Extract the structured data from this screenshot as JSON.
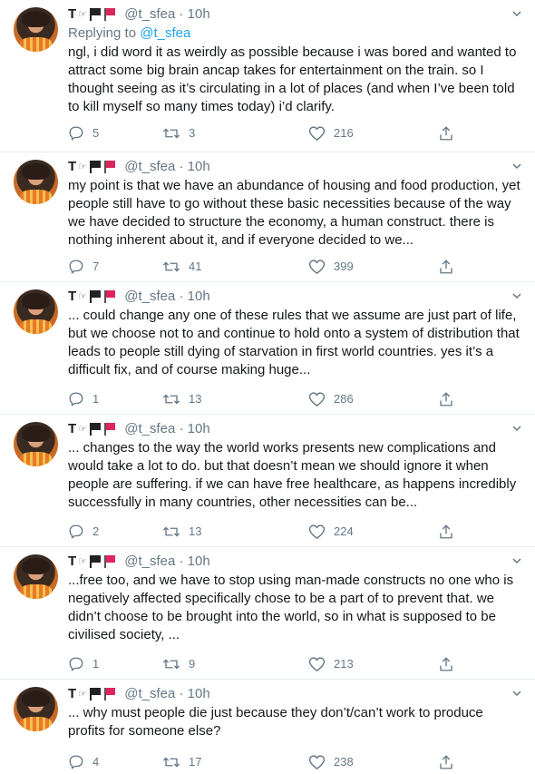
{
  "tweets": [
    {
      "name": "T",
      "handle": "@t_sfea",
      "dot": "·",
      "time": "10h",
      "replying_prefix": "Replying to",
      "replying_to": "@t_sfea",
      "text": "ngl, i did word it as weirdly as possible because i was bored and wanted to attract some big brain ancap takes for entertainment on the train. so I thought seeing as it’s circulating in a lot of places (and when I’ve been told to kill myself so many times today) i’d clarify.",
      "replies": "5",
      "retweets": "3",
      "likes": "216"
    },
    {
      "name": "T",
      "handle": "@t_sfea",
      "dot": "·",
      "time": "10h",
      "text": "my point is that we have an abundance of housing and food production, yet people still have to go without these basic necessities because of the way we have decided to structure the economy, a human construct. there is nothing inherent about it, and if everyone decided to we...",
      "replies": "7",
      "retweets": "41",
      "likes": "399"
    },
    {
      "name": "T",
      "handle": "@t_sfea",
      "dot": "·",
      "time": "10h",
      "text": "... could change any one of these rules that we assume are just part of life, but we choose not to and continue to hold onto a system of distribution that leads to people still dying of starvation in first world countries. yes it’s a difficult fix, and of course making huge...",
      "replies": "1",
      "retweets": "13",
      "likes": "286"
    },
    {
      "name": "T",
      "handle": "@t_sfea",
      "dot": "·",
      "time": "10h",
      "text": "... changes to the way the world works presents new complications and would take a lot to do. but that doesn’t mean we should ignore it when people are suffering. if we can have free healthcare, as happens incredibly successfully in many countries, other necessities can be...",
      "replies": "2",
      "retweets": "13",
      "likes": "224"
    },
    {
      "name": "T",
      "handle": "@t_sfea",
      "dot": "·",
      "time": "10h",
      "text": "...free too, and we have to stop using man-made constructs no one who is negatively affected specifically chose to be a part of to prevent that. we didn’t choose to be brought into the world, so in what is supposed to be civilised society, ...",
      "replies": "1",
      "retweets": "9",
      "likes": "213"
    },
    {
      "name": "T",
      "handle": "@t_sfea",
      "dot": "·",
      "time": "10h",
      "text": "... why must people die just because they don’t/can’t work to produce profits for someone else?",
      "replies": "4",
      "retweets": "17",
      "likes": "238"
    }
  ],
  "colors": {
    "link": "#1da1f2",
    "muted": "#657786",
    "text": "#14171a",
    "divider": "#e6ecf0"
  },
  "icons": [
    "reply-icon",
    "retweet-icon",
    "like-icon",
    "share-icon",
    "chevron-down-icon",
    "pointing-hand-emoji",
    "black-flag-icon",
    "red-flag-icon"
  ]
}
